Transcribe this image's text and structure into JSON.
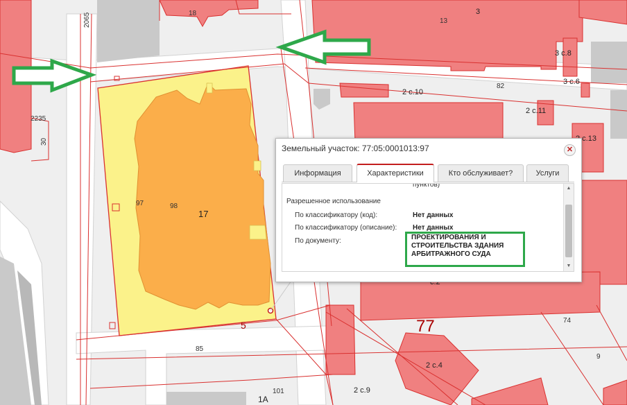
{
  "map": {
    "labels": {
      "l_18": "18",
      "l_13": "13",
      "l_3": "3",
      "l_3c8": "3 с.8",
      "l_3c6": "3 с.6",
      "l_82": "82",
      "l_2c10": "2 с.10",
      "l_2c11": "2 с.11",
      "l_2c13": "2 с.13",
      "l_2065": "2065",
      "l_2235": "2235",
      "l_30": "30",
      "l_97": "97",
      "l_98": "98",
      "l_17": "17",
      "l_5": "5",
      "l_85": "85",
      "l_101": "101",
      "l_1a": "1А",
      "l_77": "77",
      "l_74": "74",
      "l_9": "9",
      "l_2c4": "2 с.4",
      "l_2c9": "2 с.9",
      "l_c2": "с.2"
    },
    "colors": {
      "building": "#f08080",
      "building_stroke": "#d9302f",
      "parcel_fill": "#fbf28a",
      "footprint": "#fbae4a",
      "road": "#ffffff",
      "ground": "#efefef",
      "arrow": "#2ea84a"
    }
  },
  "popup": {
    "title": "Земельный участок: 77:05:0001013:97",
    "close_icon": "close-icon",
    "tabs": [
      {
        "label": "Информация"
      },
      {
        "label": "Характеристики"
      },
      {
        "label": "Кто обслуживает?"
      },
      {
        "label": "Услуги"
      }
    ],
    "active_tab": "Характеристики",
    "cut_text": "пунктов)",
    "section": "Разрешенное использование",
    "rows": [
      {
        "label": "По классификатору (код):",
        "value": "Нет данных"
      },
      {
        "label": "По классификатору (описание):",
        "value": "Нет данных"
      },
      {
        "label": "По документу:",
        "value": "ПРОЕКТИРОВАНИЯ И СТРОИТЕЛЬСТВА ЗДАНИЯ АРБИТРАЖНОГО СУДА"
      }
    ]
  }
}
